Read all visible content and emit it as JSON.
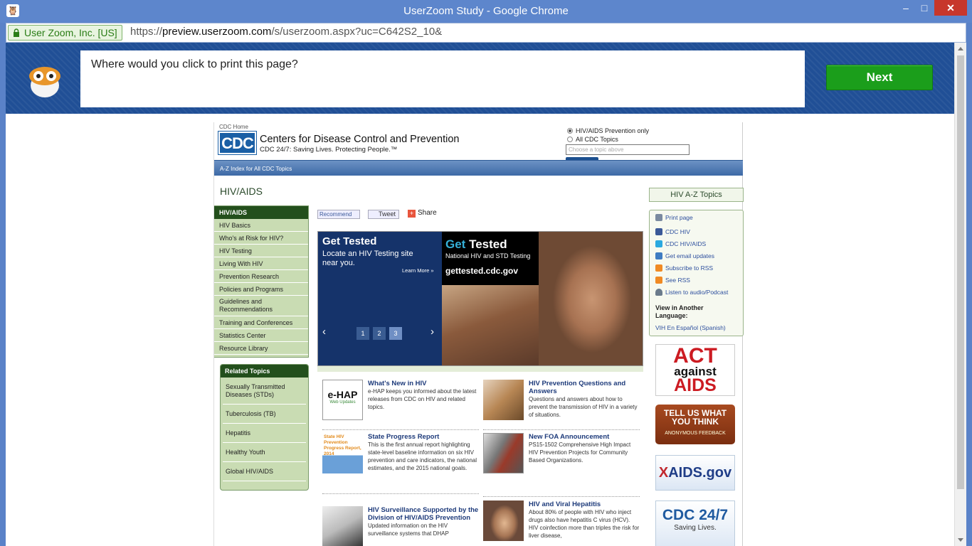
{
  "window": {
    "title": "UserZoom Study - Google Chrome",
    "min_glyph": "–",
    "max_glyph": "□",
    "close_glyph": "✕"
  },
  "address_bar": {
    "ev_label": "User Zoom, Inc. [US]",
    "url_scheme": "https://",
    "url_host": "preview.userzoom.com",
    "url_path": "/s/userzoom.aspx?uc=C642S2_10&"
  },
  "userzoom": {
    "question": "Where would you click to print this page?",
    "next_label": "Next"
  },
  "cdc": {
    "home_link": "CDC Home",
    "logo_text": "CDC",
    "org_name": "Centers for Disease Control and Prevention",
    "tagline": "CDC 24/7: Saving Lives. Protecting People.™",
    "search": {
      "option1": "HIV/AIDS Prevention only",
      "option2": "All CDC Topics",
      "placeholder": "Choose a topic above",
      "button": "SEARCH"
    },
    "az_index": "A-Z Index for All CDC Topics",
    "page_title": "HIV/AIDS",
    "left_nav": {
      "header": "HIV/AIDS",
      "items": [
        "HIV Basics",
        "Who's at Risk for HIV?",
        "HIV Testing",
        "Living With HIV",
        "Prevention Research",
        "Policies and Programs",
        "Guidelines and Recommendations",
        "Training and Conferences",
        "Statistics Center",
        "Resource Library"
      ]
    },
    "related": {
      "header": "Related Topics",
      "items": [
        "Sexually Transmitted Diseases (STDs)",
        "Tuberculosis (TB)",
        "Hepatitis",
        "Healthy Youth",
        "Global HIV/AIDS"
      ]
    },
    "social": {
      "recommend": "Recommend",
      "tweet": "Tweet",
      "share": "Share",
      "share_glyph": "+"
    },
    "carousel": {
      "title": "Get Tested",
      "text": "Locate an HIV Testing site near you.",
      "learn_more": "Learn More »",
      "prev_glyph": "‹",
      "next_glyph": "›",
      "pages": [
        "1",
        "2",
        "3"
      ],
      "promo_get": "Get",
      "promo_tested": " Tested",
      "promo_sub": "National HIV and STD Testing",
      "promo_url": "gettested.cdc.gov"
    },
    "articles": [
      {
        "title": "What's New in HIV",
        "body": "e-HAP keeps you informed about the latest releases from CDC on HIV and related topics.",
        "thumb_label": "e-HAP",
        "thumb_sub": "Web Updates"
      },
      {
        "title": "HIV Prevention Questions and Answers",
        "body": "Questions and answers about how to prevent the transmission of HIV in a variety of situations."
      },
      {
        "title": "State Progress Report",
        "body": "This is the first annual report highlighting state-level baseline information on six HIV prevention and care indicators, the national estimates, and the 2015 national goals.",
        "thumb_label": "State HIV Prevention Progress Report, 2014"
      },
      {
        "title": "New FOA Announcement",
        "body": "PS15-1502 Comprehensive High Impact HIV Prevention Projects for Community Based Organizations."
      },
      {
        "title": "HIV Surveillance Supported by the Division of HIV/AIDS Prevention",
        "body": "Updated information on the HIV surveillance systems that DHAP"
      },
      {
        "title": "HIV and Viral Hepatitis",
        "body": "About 80% of people with HIV who inject drugs also have hepatitis C virus (HCV). HIV coinfection more than triples the risk for liver disease,"
      }
    ],
    "right": {
      "az_topics": "HIV A-Z Topics",
      "tools": [
        {
          "label": "Print page",
          "icon": "printer-icon",
          "color": "#7a8aa0"
        },
        {
          "label": "CDC HIV",
          "icon": "facebook-icon",
          "color": "#3b5998"
        },
        {
          "label": "CDC HIV/AIDS",
          "icon": "twitter-icon",
          "color": "#2aa9e0"
        },
        {
          "label": "Get email updates",
          "icon": "email-icon",
          "color": "#3f7cc2"
        },
        {
          "label": "Subscribe to RSS",
          "icon": "rss-icon",
          "color": "#f08a24"
        },
        {
          "label": "See RSS",
          "icon": "rss-icon",
          "color": "#f08a24"
        },
        {
          "label": "Listen to audio/Podcast",
          "icon": "headphones-icon",
          "color": "#6b7b8c"
        }
      ],
      "lang_header": "View in Another Language:",
      "lang_link": "VIH En Español (Spanish)",
      "act_aids": {
        "line1": "ACT",
        "line2": "against",
        "line3": "AIDS"
      },
      "tell_us": {
        "line1": "TELL US WHAT YOU THINK",
        "line2": "ANONYMOUS FEEDBACK"
      },
      "aids_gov": {
        "mark": "X",
        "text": "AIDS.gov"
      },
      "cdc247": {
        "line1": "CDC 24/7",
        "line2": "Saving Lives."
      }
    }
  }
}
